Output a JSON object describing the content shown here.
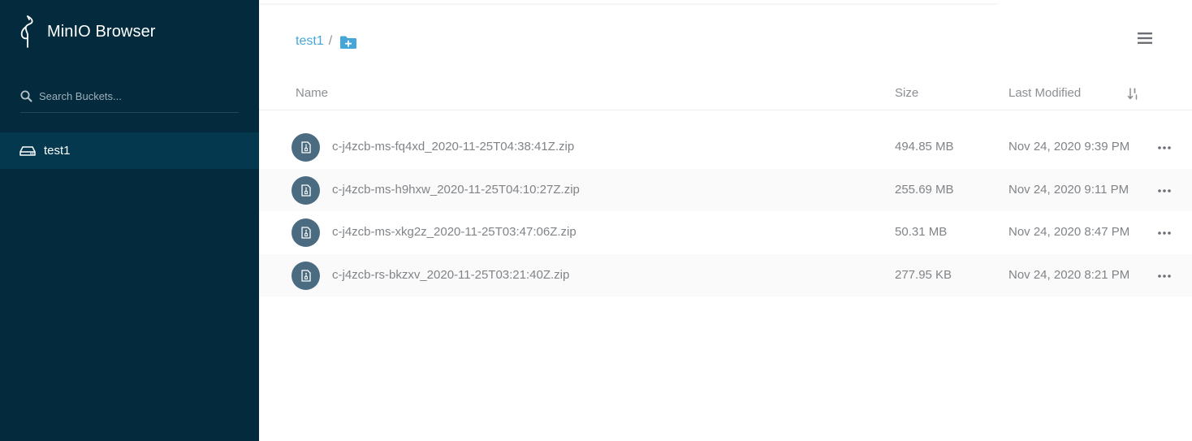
{
  "sidebar": {
    "brand_title": "MinIO Browser",
    "search": {
      "placeholder": "Search Buckets...",
      "icon": "search-icon"
    },
    "buckets": [
      {
        "label": "test1",
        "icon": "hard-drive-icon"
      }
    ]
  },
  "breadcrumb": {
    "items": [
      {
        "label": "test1"
      }
    ],
    "separator": "/",
    "add_folder_icon": "add-folder-icon"
  },
  "header_menu_icon": "hamburger-menu-icon",
  "table": {
    "columns": {
      "name": "Name",
      "size": "Size",
      "last_modified": "Last Modified"
    },
    "sort_icon": "sort-icon",
    "rows": [
      {
        "name": "c-j4zcb-ms-fq4xd_2020-11-25T04:38:41Z.zip",
        "size": "494.85 MB",
        "last_modified": "Nov 24, 2020 9:39 PM"
      },
      {
        "name": "c-j4zcb-ms-h9hxw_2020-11-25T04:10:27Z.zip",
        "size": "255.69 MB",
        "last_modified": "Nov 24, 2020 9:11 PM"
      },
      {
        "name": "c-j4zcb-ms-xkg2z_2020-11-25T03:47:06Z.zip",
        "size": "50.31 MB",
        "last_modified": "Nov 24, 2020 8:47 PM"
      },
      {
        "name": "c-j4zcb-rs-bkzxv_2020-11-25T03:21:40Z.zip",
        "size": "277.95 KB",
        "last_modified": "Nov 24, 2020 8:21 PM"
      }
    ]
  },
  "colors": {
    "sidebar_bg": "#032b3d",
    "sidebar_active_bg": "#04384f",
    "link": "#46a6d8",
    "file_icon_bg": "#4a6b80",
    "text_muted": "#808488"
  }
}
